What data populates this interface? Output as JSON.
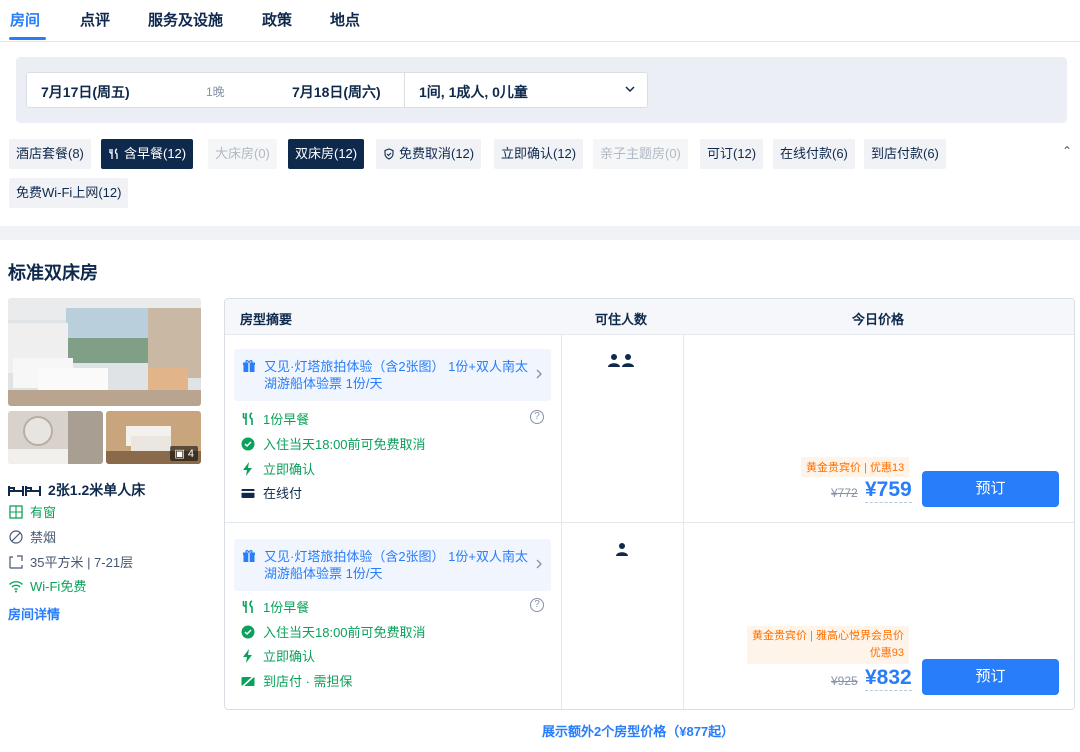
{
  "tabs": [
    "房间",
    "点评",
    "服务及设施",
    "政策",
    "地点"
  ],
  "search": {
    "checkin": "7月17日(周五)",
    "nights": "1晚",
    "checkout": "7月18日(周六)",
    "guests": "1间, 1成人, 0儿童"
  },
  "filters": [
    "酒店套餐(8)",
    "含早餐(12)",
    "大床房(0)",
    "双床房(12)",
    "免费取消(12)",
    "立即确认(12)",
    "亲子主题房(0)",
    "可订(12)",
    "在线付款(6)",
    "到店付款(6)",
    "免费Wi-Fi上网(12)"
  ],
  "room": {
    "title": "标准双床房",
    "photo_count": "4",
    "bed": "2张1.2米单人床",
    "features": [
      "有窗",
      "禁烟",
      "35平方米 | 7-21层",
      "Wi-Fi免费"
    ],
    "details_link": "房间详情"
  },
  "table": {
    "headers": [
      "房型摘要",
      "可住人数",
      "今日价格"
    ],
    "rows": [
      {
        "package": "又见·灯塔旅拍体验（含2张图） 1份+双人南太湖游船体验票 1份/天",
        "perks": [
          "1份早餐",
          "入住当天18:00前可免费取消",
          "立即确认",
          "在线付"
        ],
        "guests": 2,
        "promo_line1": "黄金贵宾价 | 优惠13",
        "promo_line2": "",
        "old_price": "¥772",
        "price": "¥759",
        "book": "预订"
      },
      {
        "package": "又见·灯塔旅拍体验（含2张图） 1份+双人南太湖游船体验票 1份/天",
        "perks": [
          "1份早餐",
          "入住当天18:00前可免费取消",
          "立即确认",
          "到店付 · 需担保"
        ],
        "guests": 1,
        "promo_line1": "黄金贵宾价 | 雅高心悦界会员价",
        "promo_line2": "优惠93",
        "old_price": "¥925",
        "price": "¥832",
        "book": "预订"
      }
    ]
  },
  "more_link": "展示额外2个房型价格（¥877起）",
  "colors": {
    "accent": "#287dfa",
    "green": "#0aa15a",
    "promo": "#ff6f00",
    "dark": "#0f294d"
  }
}
